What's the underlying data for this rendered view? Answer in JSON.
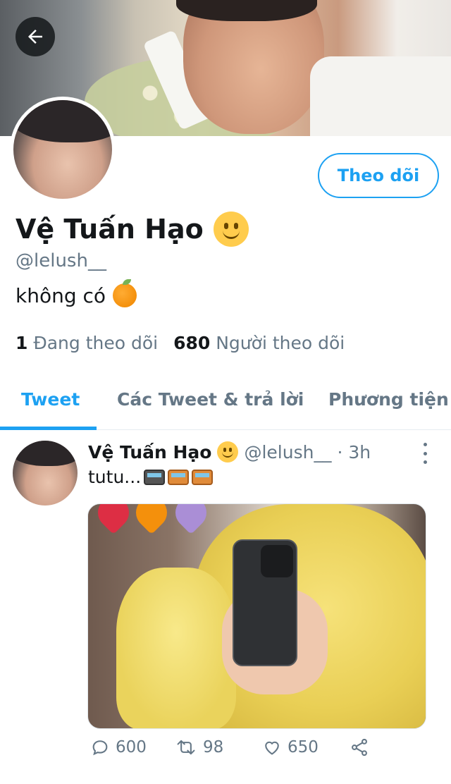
{
  "profile": {
    "follow_label": "Theo dõi",
    "display_name": "Vệ Tuấn Hạo",
    "handle": "@lelush__",
    "bio": "không có",
    "following_count": "1",
    "following_label": "Đang theo dõi",
    "followers_count": "680",
    "followers_label": "Người theo dõi",
    "emoji": "slightly-smiling-face-icon",
    "bio_emoji": "tangerine-icon"
  },
  "tabs": [
    {
      "label": "Tweet",
      "active": true
    },
    {
      "label": "Các Tweet & trả lời",
      "active": false
    },
    {
      "label": "Phương tiện",
      "active": false
    }
  ],
  "tweet": {
    "author": "Vệ Tuấn Hạo",
    "handle": "@lelush__",
    "time": "· 3h",
    "text": "tutu...",
    "text_emojis": [
      "locomotive-icon",
      "railway-car-icon",
      "railway-car-icon"
    ],
    "replies": "600",
    "retweets": "98",
    "likes": "650"
  },
  "colors": {
    "accent": "#1da1f2",
    "text": "#14171a",
    "muted": "#657786"
  }
}
